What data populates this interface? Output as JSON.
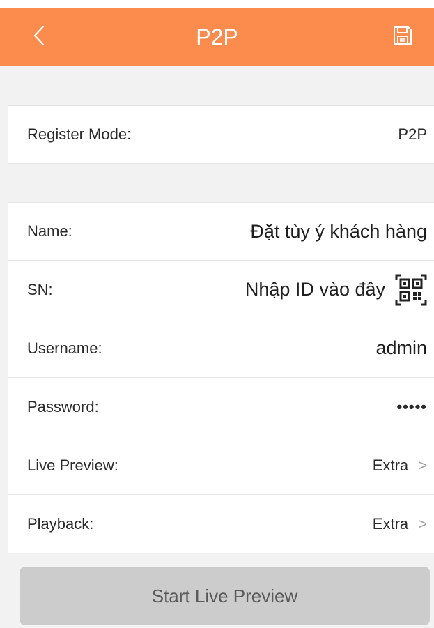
{
  "header": {
    "title": "P2P",
    "back_icon": "chevron-left-icon",
    "save_icon": "floppy-disk-icon",
    "background": "#fb8c4d"
  },
  "register": {
    "label": "Register Mode:",
    "value": "P2P"
  },
  "fields": {
    "name": {
      "label": "Name:",
      "value": "Đặt tùy ý khách hàng"
    },
    "sn": {
      "label": "SN:",
      "value": "Nhập ID vào đây",
      "icon": "qr-scan-icon"
    },
    "username": {
      "label": "Username:",
      "value": "admin"
    },
    "password": {
      "label": "Password:",
      "value": "•••••"
    },
    "live_preview": {
      "label": "Live Preview:",
      "value": "Extra",
      "chevron": ">"
    },
    "playback": {
      "label": "Playback:",
      "value": "Extra",
      "chevron": ">"
    }
  },
  "start_button": {
    "label": "Start Live Preview"
  }
}
